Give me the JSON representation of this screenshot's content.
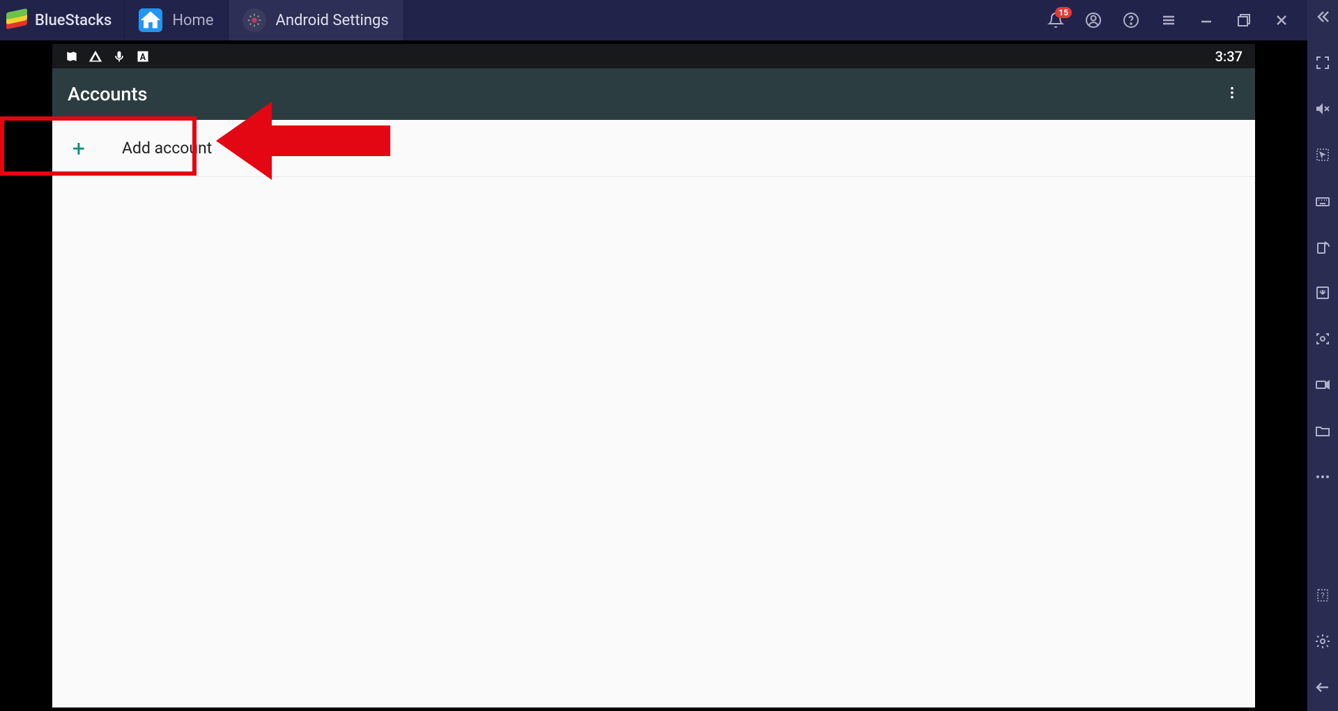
{
  "topbar": {
    "brand": "BlueStacks",
    "tabs": [
      {
        "label": "Home",
        "icon": "home"
      },
      {
        "label": "Android Settings",
        "icon": "gear"
      }
    ],
    "notification_count": "15"
  },
  "status": {
    "time": "3:37"
  },
  "app": {
    "title": "Accounts",
    "add_label": "Add account"
  }
}
